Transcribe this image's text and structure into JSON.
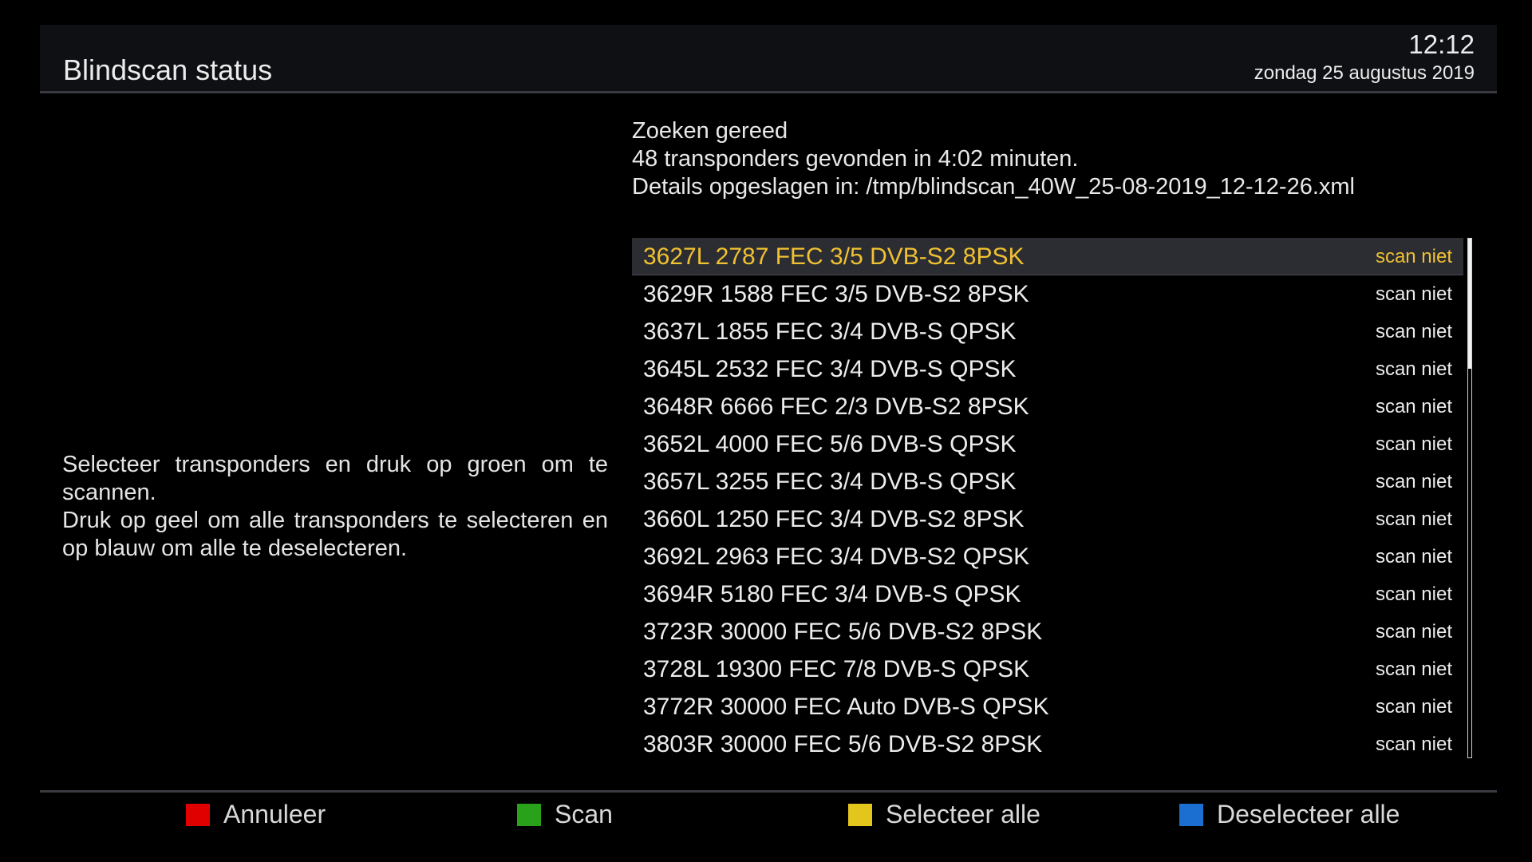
{
  "header": {
    "title": "Blindscan status",
    "time": "12:12",
    "date": "zondag 25 augustus 2019"
  },
  "status": {
    "line1": "Zoeken gereed",
    "line2": "48 transponders gevonden in 4:02 minuten.",
    "line3": "Details opgeslagen in: /tmp/blindscan_40W_25-08-2019_12-12-26.xml"
  },
  "help": {
    "line1": "Selecteer transponders en druk op groen om te scannen.",
    "line2": "Druk op geel om alle transponders te selecteren en op blauw om alle te deselecteren."
  },
  "transponders": [
    {
      "label": "3627L 2787 FEC 3/5 DVB-S2 8PSK",
      "state": "scan niet"
    },
    {
      "label": "3629R 1588 FEC 3/5 DVB-S2 8PSK",
      "state": "scan niet"
    },
    {
      "label": "3637L 1855 FEC 3/4 DVB-S QPSK",
      "state": "scan niet"
    },
    {
      "label": "3645L 2532 FEC 3/4 DVB-S QPSK",
      "state": "scan niet"
    },
    {
      "label": "3648R 6666 FEC 2/3 DVB-S2 8PSK",
      "state": "scan niet"
    },
    {
      "label": "3652L 4000 FEC 5/6 DVB-S QPSK",
      "state": "scan niet"
    },
    {
      "label": "3657L 3255 FEC 3/4 DVB-S QPSK",
      "state": "scan niet"
    },
    {
      "label": "3660L 1250 FEC 3/4 DVB-S2 8PSK",
      "state": "scan niet"
    },
    {
      "label": "3692L 2963 FEC 3/4 DVB-S2 QPSK",
      "state": "scan niet"
    },
    {
      "label": "3694R 5180 FEC 3/4 DVB-S QPSK",
      "state": "scan niet"
    },
    {
      "label": "3723R 30000 FEC 5/6 DVB-S2 8PSK",
      "state": "scan niet"
    },
    {
      "label": "3728L 19300 FEC 7/8 DVB-S QPSK",
      "state": "scan niet"
    },
    {
      "label": "3772R 30000 FEC Auto DVB-S QPSK",
      "state": "scan niet"
    },
    {
      "label": "3803R 30000 FEC 5/6 DVB-S2 8PSK",
      "state": "scan niet"
    }
  ],
  "selected_index": 0,
  "scroll": {
    "visible_fraction": 0.25
  },
  "colors": {
    "selected_text": "#f0c131",
    "red_key": "#e00000",
    "green_key": "#2aa11a",
    "yellow_key": "#e3c61c",
    "blue_key": "#1a6fd0"
  },
  "footer": {
    "red": {
      "label": "Annuleer",
      "icon": "red-key-icon"
    },
    "green": {
      "label": "Scan",
      "icon": "green-key-icon"
    },
    "yellow": {
      "label": "Selecteer alle",
      "icon": "yellow-key-icon"
    },
    "blue": {
      "label": "Deselecteer alle",
      "icon": "blue-key-icon"
    }
  }
}
